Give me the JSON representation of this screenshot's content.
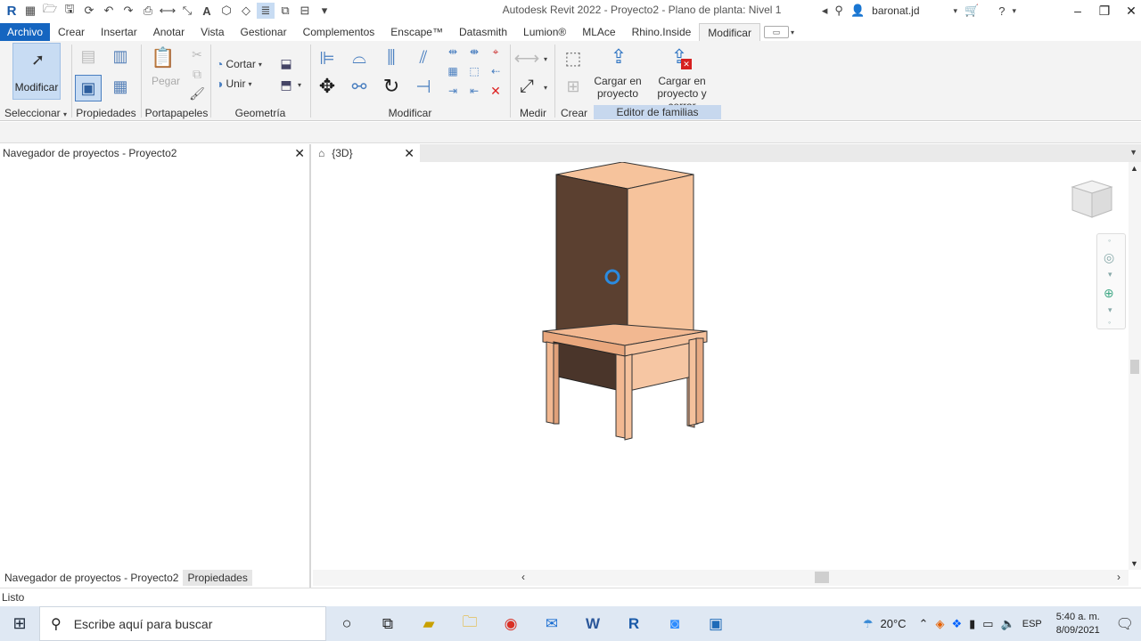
{
  "window": {
    "title": "Autodesk Revit 2022 - Proyecto2 - Plano de planta: Nivel 1",
    "user": "baronat.jd"
  },
  "menu": {
    "tabs": [
      "Archivo",
      "Crear",
      "Insertar",
      "Anotar",
      "Vista",
      "Gestionar",
      "Complementos",
      "Enscape™",
      "Datasmith",
      "Lumion®",
      "MLAce",
      "Rhino.Inside",
      "Modificar"
    ],
    "active": "Modificar"
  },
  "ribbon": {
    "modify_button": "Modificar",
    "paste_label": "Pegar",
    "cut_label": "Cortar",
    "join_label": "Unir",
    "load_project": "Cargar en proyecto",
    "load_project_line1": "Cargar en",
    "load_project_line2": "proyecto",
    "load_close_line1": "Cargar en",
    "load_close_line2": "proyecto y cerrar",
    "panels": {
      "select": "Seleccionar",
      "properties": "Propiedades",
      "clipboard": "Portapapeles",
      "geometry": "Geometría",
      "modify": "Modificar",
      "measure": "Medir",
      "create": "Crear",
      "family_editor": "Editor de familias"
    }
  },
  "browser": {
    "title": "Navegador de proyectos - Proyecto2",
    "tab_browser": "Navegador de proyectos - Proyecto2",
    "tab_properties": "Propiedades"
  },
  "view": {
    "tab_label": "{3D}"
  },
  "status": {
    "text": "Listo"
  },
  "taskbar": {
    "search_placeholder": "Escribe aquí para buscar",
    "temperature": "20°C",
    "language": "ESP",
    "time": "5:40 a. m.",
    "date": "8/09/2021"
  }
}
